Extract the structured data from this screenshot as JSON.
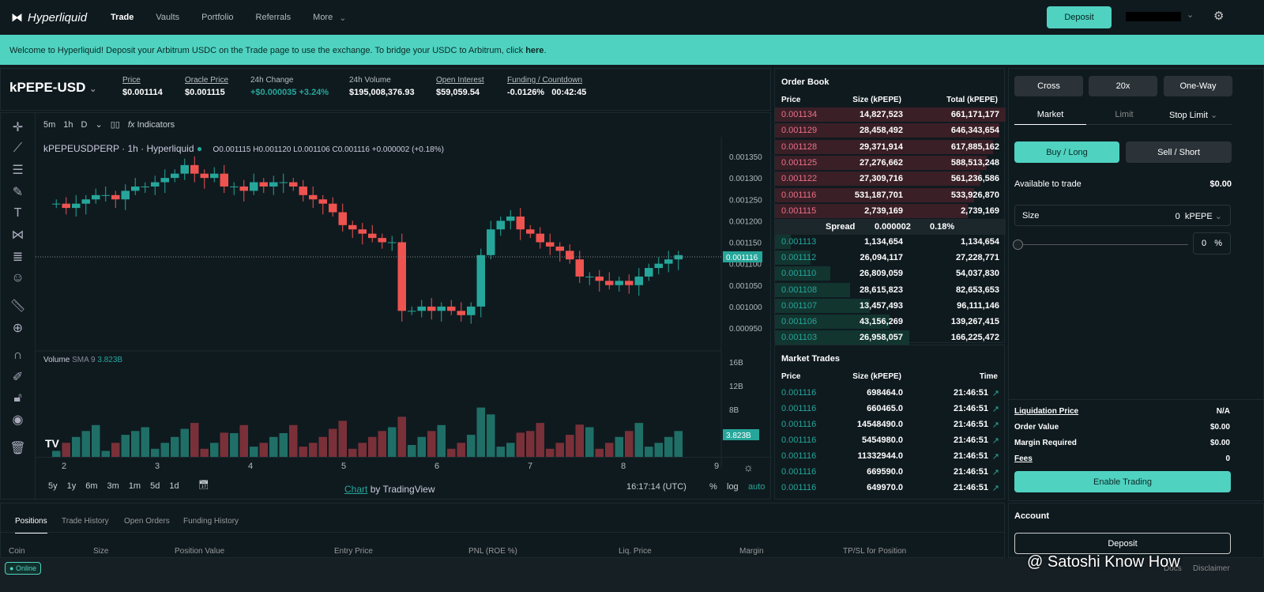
{
  "nav": {
    "brand": "Hyperliquid",
    "items": [
      "Trade",
      "Vaults",
      "Portfolio",
      "Referrals",
      "More"
    ],
    "deposit": "Deposit"
  },
  "banner": {
    "text": "Welcome to Hyperliquid! Deposit your Arbitrum USDC on the Trade page to use the exchange. To bridge your USDC to Arbitrum, click ",
    "link": "here",
    "end": "."
  },
  "market": {
    "pair": "kPEPE-USD",
    "stats": [
      {
        "label": "Price",
        "value": "$0.001114"
      },
      {
        "label": "Oracle Price",
        "value": "$0.001115"
      },
      {
        "label": "24h Change",
        "value": "+$0.000035 +3.24%"
      },
      {
        "label": "24h Volume",
        "value": "$195,008,376.93"
      },
      {
        "label": "Open Interest",
        "value": "$59,059.54"
      },
      {
        "label": "Funding / Countdown",
        "value": "-0.0126%",
        "value2": "00:42:45"
      }
    ]
  },
  "chart": {
    "intervals": [
      "5m",
      "1h",
      "D"
    ],
    "indicators": "Indicators",
    "symbol": "kPEPEUSDPERP · 1h · Hyperliquid",
    "ohlc": "O0.001115 H0.001120 L0.001106 C0.001116 +0.000002 (+0.18%)",
    "price_ticks": [
      "0.001350",
      "0.001300",
      "0.001250",
      "0.001200",
      "0.001150",
      "0.001100",
      "0.001050",
      "0.001000",
      "0.000950"
    ],
    "last_price": "0.001116",
    "volume_label": "Volume",
    "sma": "SMA 9",
    "sma_val": "3.823B",
    "vol_ticks": [
      "16B",
      "12B",
      "8B"
    ],
    "vol_last": "3.823B",
    "x_ticks": [
      "2",
      "3",
      "4",
      "5",
      "6",
      "7",
      "8",
      "9"
    ],
    "ranges": [
      "5y",
      "1y",
      "6m",
      "3m",
      "1m",
      "5d",
      "1d"
    ],
    "credit_link": "Chart",
    "credit": "by TradingView",
    "time": "16:17:14 (UTC)",
    "scale": [
      "%",
      "log",
      "auto"
    ],
    "closes": [
      0.00124,
      0.00123,
      0.00124,
      0.00125,
      0.00126,
      0.00126,
      0.00125,
      0.00127,
      0.00128,
      0.00128,
      0.00129,
      0.0013,
      0.00131,
      0.00133,
      0.00131,
      0.0013,
      0.00131,
      0.00128,
      0.00128,
      0.00127,
      0.00129,
      0.00128,
      0.00129,
      0.00129,
      0.00128,
      0.00126,
      0.00125,
      0.00124,
      0.00122,
      0.00119,
      0.00118,
      0.00117,
      0.00116,
      0.00115,
      0.00115,
      0.00099,
      0.00099,
      0.001,
      0.00099,
      0.001,
      0.00099,
      0.00098,
      0.001,
      0.00112,
      0.00118,
      0.0012,
      0.00121,
      0.00118,
      0.00117,
      0.00115,
      0.00114,
      0.00113,
      0.00111,
      0.00107,
      0.00107,
      0.00106,
      0.00105,
      0.00106,
      0.00105,
      0.00107,
      0.00109,
      0.0011,
      0.00111,
      0.00112
    ]
  },
  "orderbook": {
    "title": "Order Book",
    "headers": [
      "Price",
      "Size (kPEPE)",
      "Total (kPEPE)"
    ],
    "asks": [
      [
        "0.001134",
        "14,827,523",
        "661,171,177"
      ],
      [
        "0.001129",
        "28,458,492",
        "646,343,654"
      ],
      [
        "0.001128",
        "29,371,914",
        "617,885,162"
      ],
      [
        "0.001125",
        "27,276,662",
        "588,513,248"
      ],
      [
        "0.001122",
        "27,309,716",
        "561,236,586"
      ],
      [
        "0.001116",
        "531,187,701",
        "533,926,870"
      ],
      [
        "0.001115",
        "2,739,169",
        "2,739,169"
      ]
    ],
    "spread": [
      "Spread",
      "0.000002",
      "0.18%"
    ],
    "bids": [
      [
        "0.001113",
        "1,134,654",
        "1,134,654"
      ],
      [
        "0.001112",
        "26,094,117",
        "27,228,771"
      ],
      [
        "0.001110",
        "26,809,059",
        "54,037,830"
      ],
      [
        "0.001108",
        "28,615,823",
        "82,653,653"
      ],
      [
        "0.001107",
        "13,457,493",
        "96,111,146"
      ],
      [
        "0.001106",
        "43,156,269",
        "139,267,415"
      ],
      [
        "0.001103",
        "26,958,057",
        "166,225,472"
      ]
    ]
  },
  "trades": {
    "title": "Market Trades",
    "headers": [
      "Price",
      "Size (kPEPE)",
      "Time"
    ],
    "rows": [
      [
        "0.001116",
        "698464.0",
        "21:46:51"
      ],
      [
        "0.001116",
        "660465.0",
        "21:46:51"
      ],
      [
        "0.001116",
        "14548490.0",
        "21:46:51"
      ],
      [
        "0.001116",
        "5454980.0",
        "21:46:51"
      ],
      [
        "0.001116",
        "11332944.0",
        "21:46:51"
      ],
      [
        "0.001116",
        "669590.0",
        "21:46:51"
      ],
      [
        "0.001116",
        "649970.0",
        "21:46:51"
      ]
    ]
  },
  "order": {
    "margin_mode": "Cross",
    "leverage": "20x",
    "position_mode": "One-Way",
    "tabs": [
      "Market",
      "Limit",
      "Stop Limit"
    ],
    "buy": "Buy / Long",
    "sell": "Sell / Short",
    "available_label": "Available to trade",
    "available": "$0.00",
    "size_label": "Size",
    "size_value": "0",
    "size_unit": "kPEPE",
    "pct": "0",
    "pct_sym": "%",
    "slider_pct": 0,
    "info": [
      [
        "Liquidation Price",
        "N/A"
      ],
      [
        "Order Value",
        "$0.00"
      ],
      [
        "Margin Required",
        "$0.00"
      ],
      [
        "Fees",
        "0"
      ]
    ],
    "enable": "Enable Trading",
    "account": "Account",
    "deposit": "Deposit"
  },
  "bottom": {
    "tabs": [
      "Positions",
      "Trade History",
      "Open Orders",
      "Funding History"
    ],
    "columns": [
      "Coin",
      "Size",
      "Position Value",
      "Entry Price",
      "PNL (ROE %)",
      "Liq. Price",
      "Margin",
      "TP/SL for Position"
    ]
  },
  "footer": {
    "status": "Online",
    "links": [
      "Docs",
      "Disclaimer"
    ],
    "watermark": "@ Satoshi Know How"
  }
}
